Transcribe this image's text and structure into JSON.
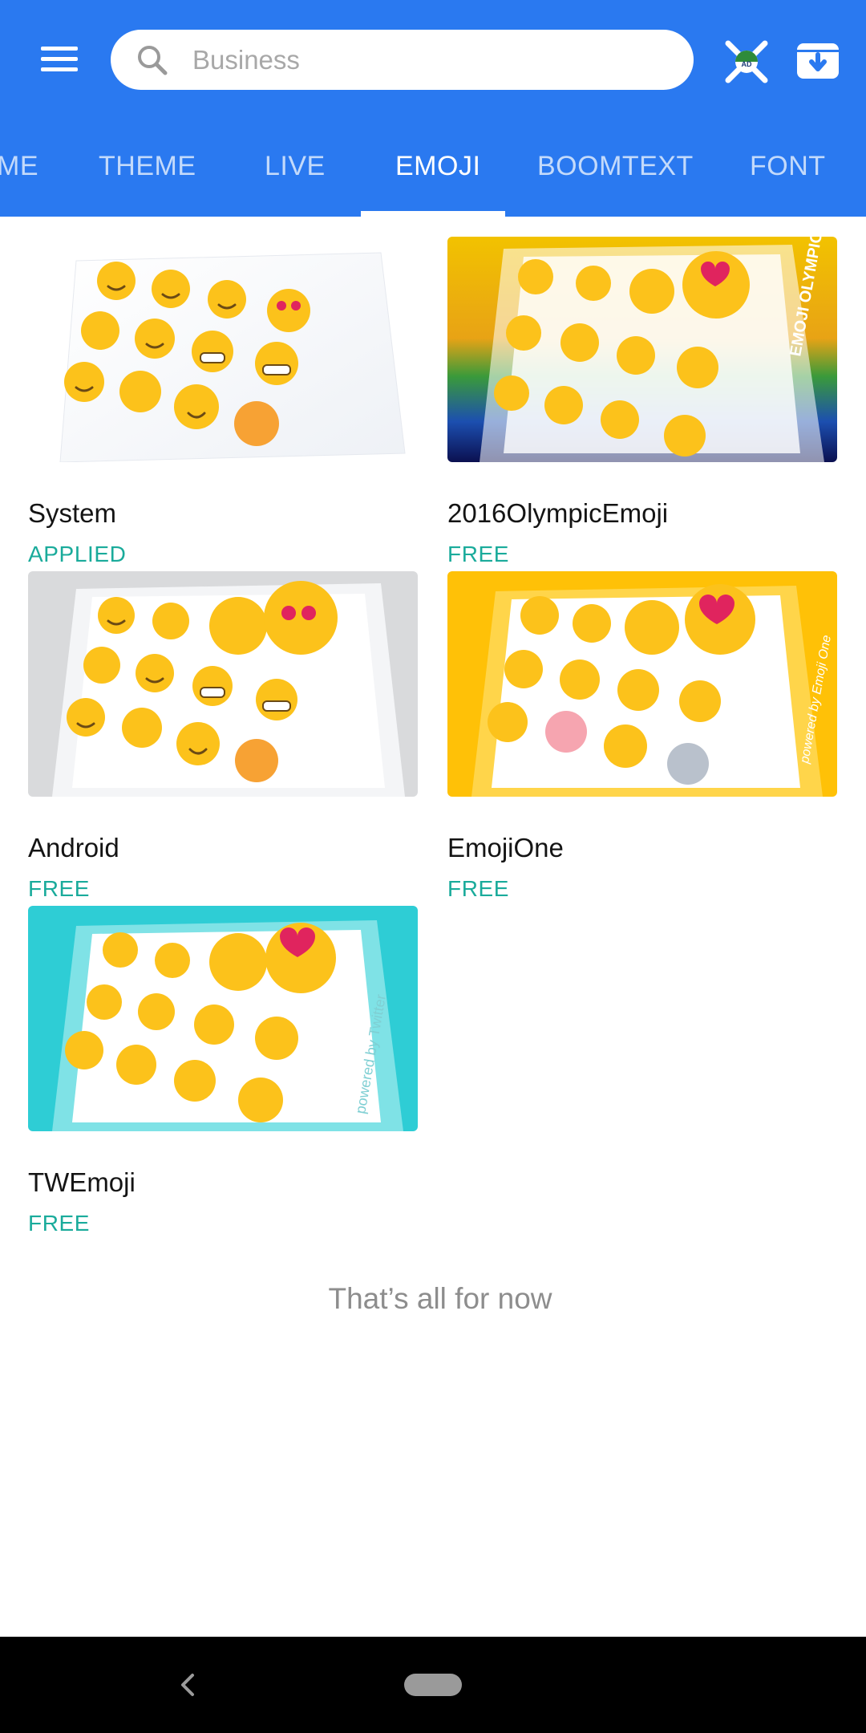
{
  "search": {
    "placeholder": "Business",
    "icon": "search-icon"
  },
  "header": {
    "menu_icon": "menu-icon",
    "ad_icon": "remove-ads-icon",
    "store_icon": "download-box-icon"
  },
  "tabs": [
    {
      "label": "ME"
    },
    {
      "label": "THEME"
    },
    {
      "label": "LIVE"
    },
    {
      "label": "EMOJI",
      "active": true
    },
    {
      "label": "BOOMTEXT"
    },
    {
      "label": "FONT"
    }
  ],
  "cards": [
    {
      "title": "System",
      "status": "APPLIED"
    },
    {
      "title": "2016OlympicEmoji",
      "status": "FREE",
      "thumb_text": "EMOJI OLYMPICS"
    },
    {
      "title": "Android",
      "status": "FREE"
    },
    {
      "title": "EmojiOne",
      "status": "FREE",
      "thumb_text": "powered by Emoji One"
    },
    {
      "title": "TWEmoji",
      "status": "FREE",
      "thumb_text": "powered by Twitter"
    }
  ],
  "footer": {
    "note": "That’s all for now"
  },
  "colors": {
    "primary": "#2a79f0",
    "status": "#1aab9b",
    "emoji": "#fcc21b"
  }
}
